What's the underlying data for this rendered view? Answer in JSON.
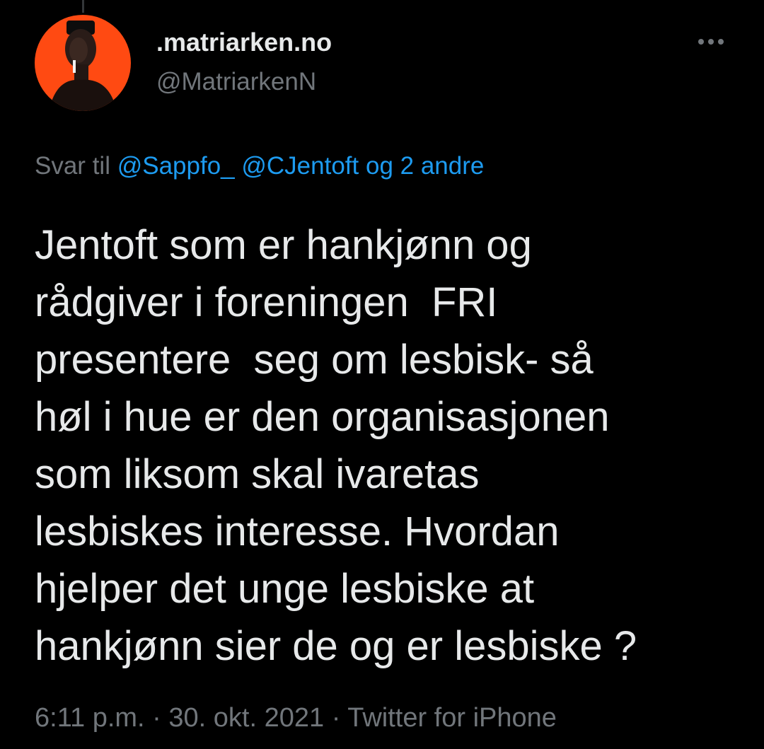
{
  "tweet": {
    "author": {
      "display_name": ".matriarken.no",
      "handle": "@MatriarkenN",
      "avatar": "avatar-portrait"
    },
    "more_icon": "more-horizontal-icon",
    "reply_to": {
      "prefix": "Svar til",
      "mention_1": "@Sappfo_",
      "mention_2": "@CJentoft",
      "connector": "og",
      "others": "2 andre"
    },
    "text": "Jentoft som er hankjønn og\nrådgiver i foreningen  FRI\npresentere  seg om lesbisk- så\nhøl i hue er den organisasjonen\nsom liksom skal ivaretas\nlesbiskes interesse. Hvordan\nhjelper det unge lesbiske at\nhankjønn sier de og er lesbiske ?",
    "meta": {
      "time": "6:11 p.m.",
      "separator": "·",
      "date": "30. okt. 2021",
      "source": "Twitter for iPhone"
    }
  },
  "colors": {
    "background": "#000000",
    "text_primary": "#e7e9ea",
    "text_secondary": "#71767b",
    "link": "#1d9bf0",
    "avatar_bg": "#ff4a12"
  }
}
